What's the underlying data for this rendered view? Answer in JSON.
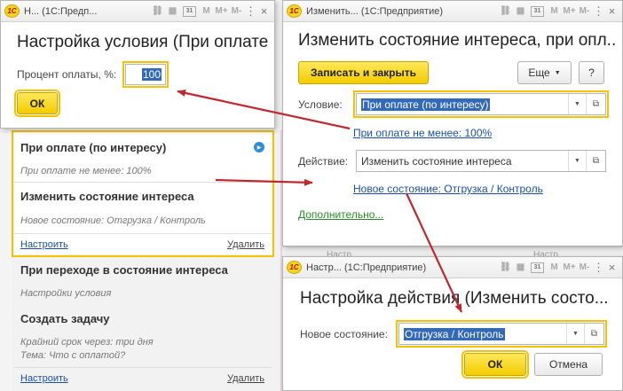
{
  "win_top_left": {
    "title": "Н... (1С:Предп...",
    "tools": [
      "M",
      "M+",
      "M-"
    ],
    "heading": "Настройка условия (При оплате (...",
    "percent_label": "Процент оплаты, %:",
    "percent_value": "100",
    "ok_label": "ОК"
  },
  "win_right": {
    "title": "Изменить... (1С:Предприятие)",
    "heading": "Изменить состояние интереса, при опл...",
    "save_close_label": "Записать и закрыть",
    "more_label": "Еще",
    "help_label": "?",
    "condition_label": "Условие:",
    "condition_value": "При оплате (по интересу)",
    "condition_link": "При оплате не менее: 100%",
    "action_label": "Действие:",
    "action_value": "Изменить состояние интереса",
    "state_link": "Новое состояние: Отгрузка / Контроль",
    "extra_link": "Дополнительно...",
    "bg_snippet": "Настр...",
    "bg_snippet2": "Настр..."
  },
  "win_bottom": {
    "title": "Настр... (1С:Предприятие)",
    "heading": "Настройка действия (Изменить состо...",
    "state_label": "Новое состояние:",
    "state_value": "Отгрузка / Контроль",
    "ok_label": "ОК",
    "cancel_label": "Отмена"
  },
  "list": {
    "card1": {
      "title": "При оплате (по интересу)",
      "subtitle": "При оплате не менее: 100%",
      "action": "Изменить состояние интереса",
      "action_sub": "Новое состояние: Отгрузка / Контроль",
      "configure": "Настроить",
      "delete": "Удалить"
    },
    "card2": {
      "title": "При переходе в состояние интереса",
      "subtitle": "Настройки условия",
      "action": "Создать задачу",
      "action_sub1": "Крайний срок через: три дня",
      "action_sub2": "Тема: Что с оплатой?",
      "configure": "Настроить",
      "delete": "Удалить"
    }
  },
  "colors": {
    "accent_yellow": "#f4c200",
    "arrow_red": "#c0272d",
    "link_blue": "#1b4fa5",
    "selection_blue": "#3269b8"
  }
}
